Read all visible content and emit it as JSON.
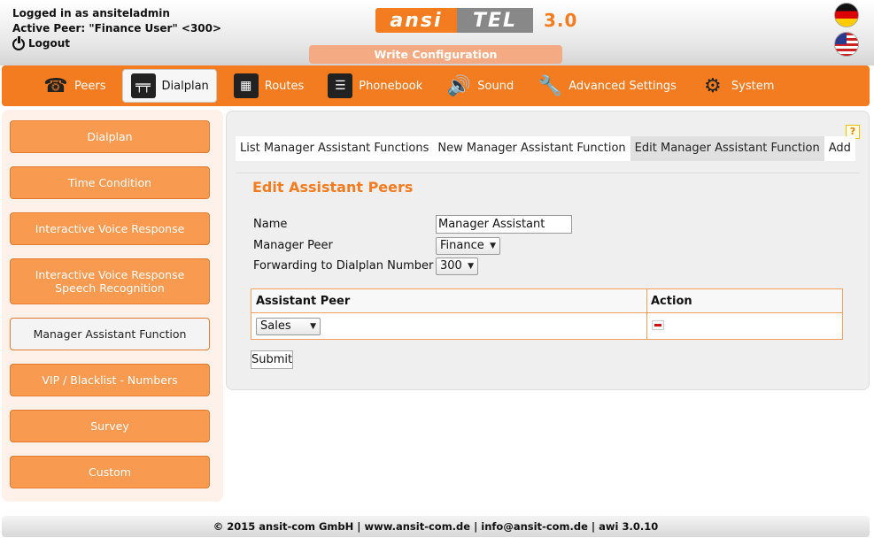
{
  "header": {
    "logged_in": "Logged in as ansiteladmin",
    "active_peer": "Active Peer: \"Finance User\" <300>",
    "logout": "Logout",
    "logo_left": "ansi",
    "logo_right": "TEL",
    "logo_version": "3.0",
    "write_config": "Write Configuration",
    "accent_color": "#f47c20"
  },
  "nav": {
    "items": [
      {
        "label": "Peers",
        "icon": "phone-icon"
      },
      {
        "label": "Dialplan",
        "icon": "dialplan-icon",
        "active": true
      },
      {
        "label": "Routes",
        "icon": "routes-icon"
      },
      {
        "label": "Phonebook",
        "icon": "phonebook-icon"
      },
      {
        "label": "Sound",
        "icon": "speaker-icon"
      },
      {
        "label": "Advanced Settings",
        "icon": "wrench-icon"
      },
      {
        "label": "System",
        "icon": "gear-icon"
      }
    ]
  },
  "sidebar": {
    "items": [
      {
        "label": "Dialplan"
      },
      {
        "label": "Time Condition"
      },
      {
        "label": "Interactive Voice Response"
      },
      {
        "label": "Interactive Voice Response Speech Recognition"
      },
      {
        "label": "Manager Assistant Function",
        "active": true
      },
      {
        "label": "VIP / Blacklist - Numbers"
      },
      {
        "label": "Survey"
      },
      {
        "label": "Custom"
      }
    ]
  },
  "tabs": [
    {
      "label": "List Manager Assistant Functions"
    },
    {
      "label": "New Manager Assistant Function"
    },
    {
      "label": "Edit Manager Assistant Function",
      "active": true
    },
    {
      "label": "Add"
    }
  ],
  "form": {
    "title": "Edit Assistant Peers",
    "name_label": "Name",
    "name_value": "Manager Assistant",
    "manager_peer_label": "Manager Peer",
    "manager_peer_value": "Finance",
    "forwarding_label": "Forwarding to Dialplan Number",
    "forwarding_value": "300",
    "table": {
      "col_assistant": "Assistant Peer",
      "col_action": "Action",
      "row_assistant_value": "Sales"
    },
    "submit_label": "Submit",
    "help": "?"
  },
  "footer": {
    "text": "© 2015 ansit-com GmbH | www.ansit-com.de | info@ansit-com.de | awi 3.0.10"
  }
}
